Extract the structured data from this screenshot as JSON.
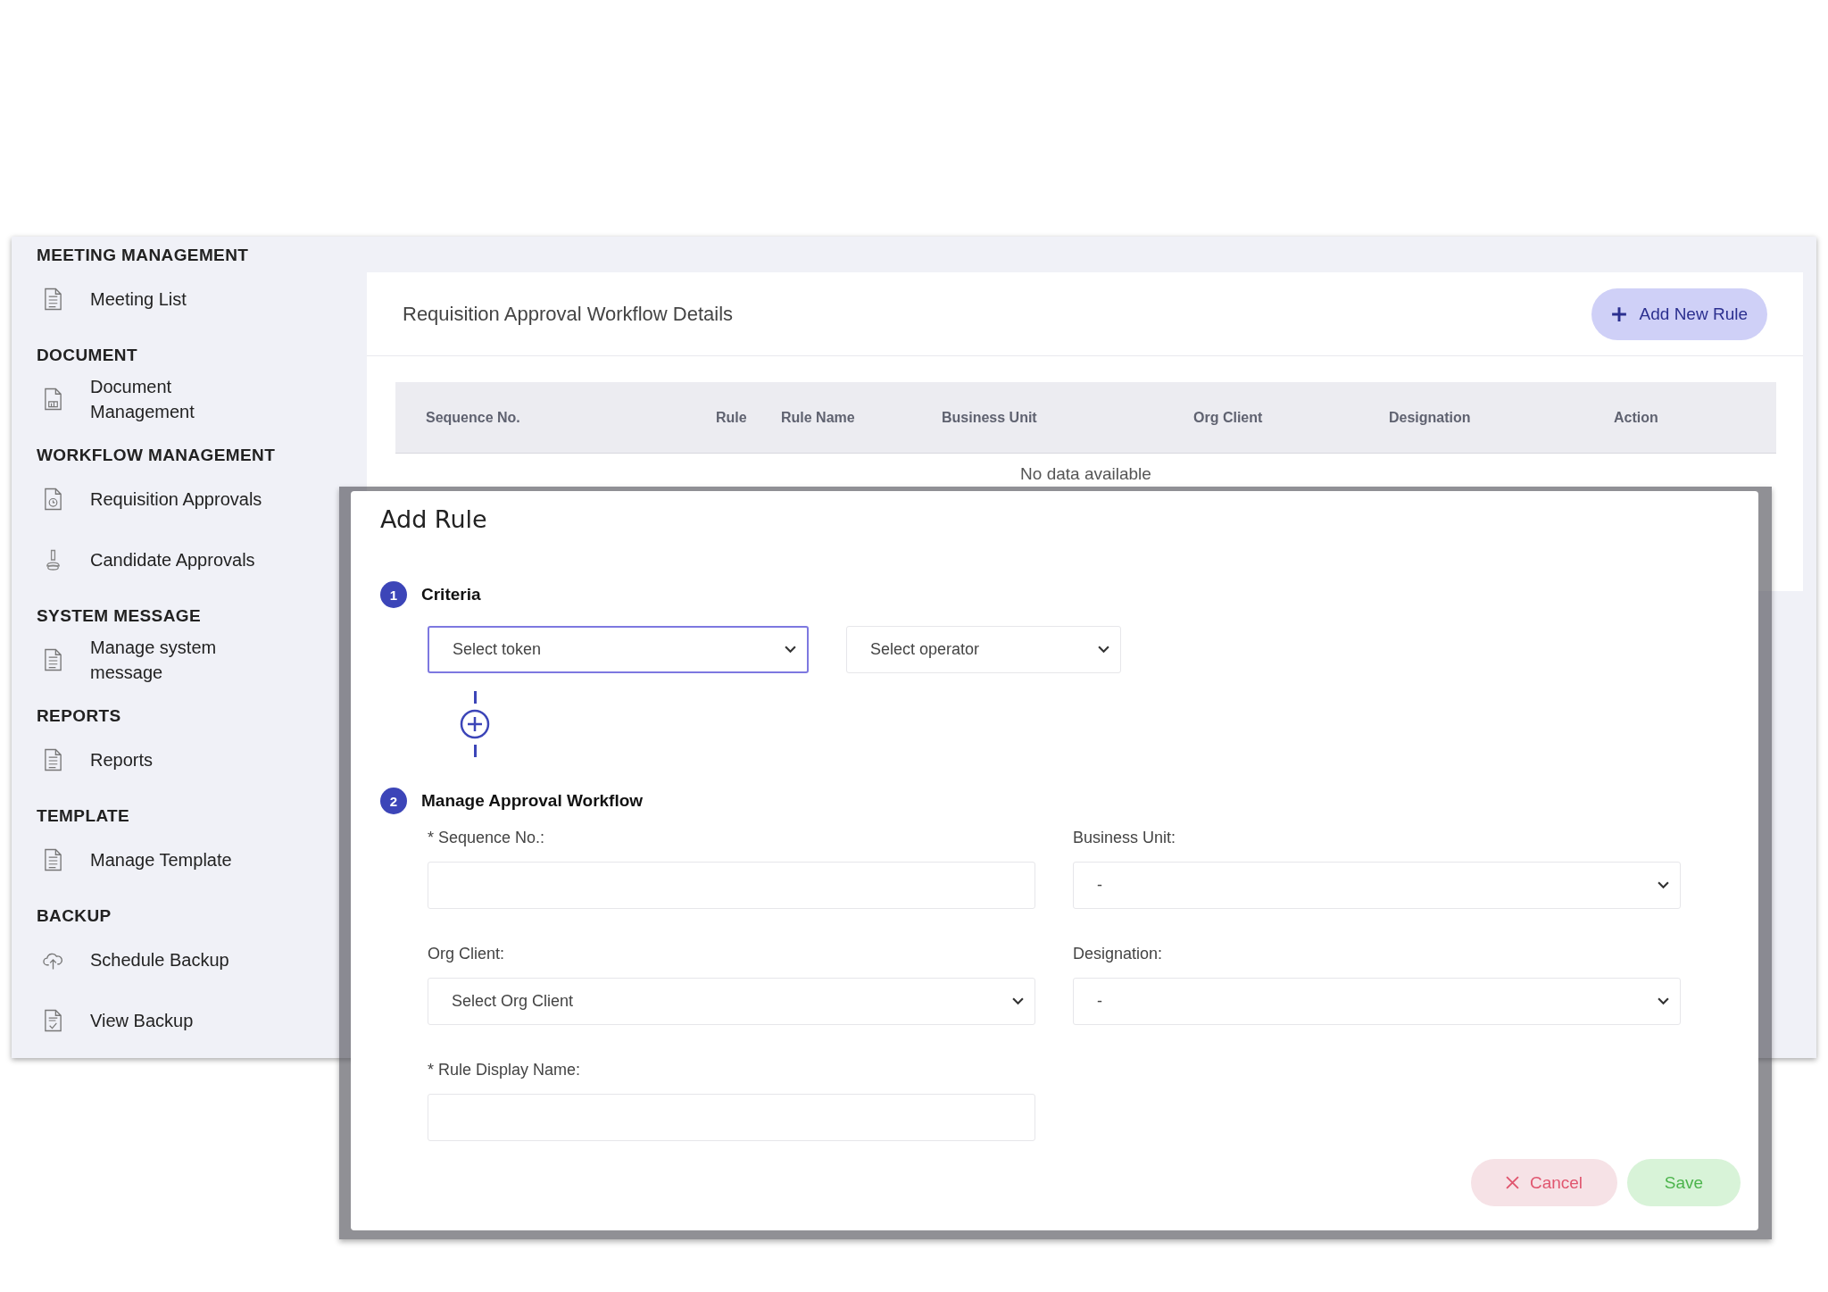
{
  "sidebar": {
    "sections": [
      {
        "title": "MEETING MANAGEMENT",
        "items": [
          {
            "label": "Meeting List",
            "kind": "document"
          }
        ]
      },
      {
        "title": "DOCUMENT",
        "items": [
          {
            "label": "Document Management",
            "kind": "chart"
          }
        ]
      },
      {
        "title": "WORKFLOW MANAGEMENT",
        "items": [
          {
            "label": "Requisition Approvals",
            "kind": "clock"
          },
          {
            "label": "Candidate Approvals",
            "kind": "stamp"
          }
        ]
      },
      {
        "title": "SYSTEM MESSAGE",
        "items": [
          {
            "label": "Manage system message",
            "kind": "document"
          }
        ]
      },
      {
        "title": "REPORTS",
        "items": [
          {
            "label": "Reports",
            "kind": "document"
          }
        ]
      },
      {
        "title": "TEMPLATE",
        "items": [
          {
            "label": "Manage Template",
            "kind": "document"
          }
        ]
      },
      {
        "title": "BACKUP",
        "items": [
          {
            "label": "Schedule Backup",
            "kind": "cloud"
          },
          {
            "label": "View Backup",
            "kind": "check"
          }
        ]
      }
    ]
  },
  "panel": {
    "title": "Requisition Approval Workflow Details",
    "add_button": "Add New Rule",
    "table": {
      "columns": [
        "Sequence No.",
        "Rule",
        "Rule Name",
        "Business Unit",
        "Org Client",
        "Designation",
        "Action"
      ],
      "empty_text": "No data available"
    }
  },
  "modal": {
    "title": "Add Rule",
    "steps": [
      {
        "number": "1",
        "title": "Criteria"
      },
      {
        "number": "2",
        "title": "Manage Approval Workflow"
      }
    ],
    "criteria": [
      {
        "placeholder": "Select token",
        "focused": true
      },
      {
        "placeholder": "Select operator",
        "focused": false
      }
    ],
    "fields": [
      {
        "kind": "input",
        "label": "* Sequence No.:"
      },
      {
        "kind": "select",
        "label": "Business Unit:",
        "value": "-"
      },
      {
        "kind": "select",
        "label": "Org Client:",
        "value": "Select Org Client"
      },
      {
        "kind": "select",
        "label": "Designation:",
        "value": "-"
      },
      {
        "kind": "input",
        "label": "* Rule Display Name:"
      }
    ],
    "buttons": {
      "cancel": "Cancel",
      "save": "Save"
    }
  }
}
